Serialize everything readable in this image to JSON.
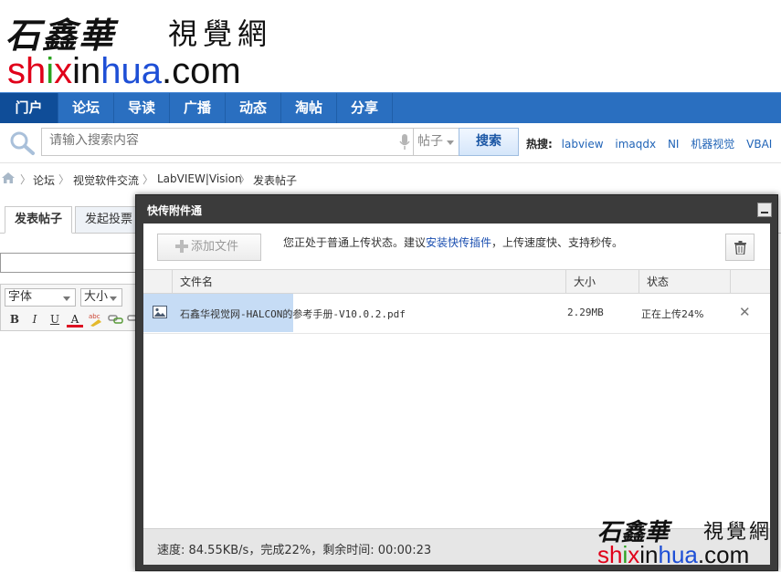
{
  "logo": {
    "cn_script": "石鑫華",
    "cn_seal": "視覺網",
    "domain_parts": [
      "sh",
      "i",
      "x",
      "in",
      "hua",
      ".com"
    ]
  },
  "nav": {
    "items": [
      {
        "label": "门户",
        "active": true
      },
      {
        "label": "论坛"
      },
      {
        "label": "导读"
      },
      {
        "label": "广播"
      },
      {
        "label": "动态"
      },
      {
        "label": "淘帖"
      },
      {
        "label": "分享"
      }
    ]
  },
  "search": {
    "placeholder": "请输入搜索内容",
    "scope": "帖子",
    "button": "搜索",
    "hot_label": "热搜:",
    "hot_items": [
      "labview",
      "imaqdx",
      "NI",
      "机器视觉",
      "VBAI"
    ]
  },
  "breadcrumb": [
    "论坛",
    "视觉软件交流",
    "LabVIEW|Vision",
    "发表帖子"
  ],
  "editor": {
    "tabs": [
      "发表帖子",
      "发起投票"
    ],
    "font": "字体",
    "size": "大小",
    "format_buttons": [
      "B",
      "I",
      "U",
      "A"
    ]
  },
  "dialog": {
    "title": "快传附件通",
    "add_button": "添加文件",
    "notice_pre": "您正处于普通上传状态。建议",
    "notice_link": "安装快传插件",
    "notice_post": "，上传速度快、支持秒传。",
    "columns": {
      "name": "文件名",
      "size": "大小",
      "status": "状态"
    },
    "files": [
      {
        "name": "石鑫华视觉网-HALCON的参考手册-V10.0.2.pdf",
        "size": "2.29MB",
        "status": "正在上传24%"
      }
    ],
    "speed_text": "速度: 84.55KB/s，完成22%，剩余时间: 00:00:23"
  },
  "watermark": {
    "cn_script": "石鑫華",
    "cn_seal": "視覺網",
    "domain_parts": [
      "sh",
      "i",
      "x",
      "in",
      "hua",
      ".com"
    ]
  },
  "colors": {
    "nav": "#2a6fc0",
    "nav_active": "#0f4d98",
    "link": "#2164b7",
    "red": "#e0001a",
    "green": "#2aa31f",
    "blue": "#1e4fd6"
  }
}
